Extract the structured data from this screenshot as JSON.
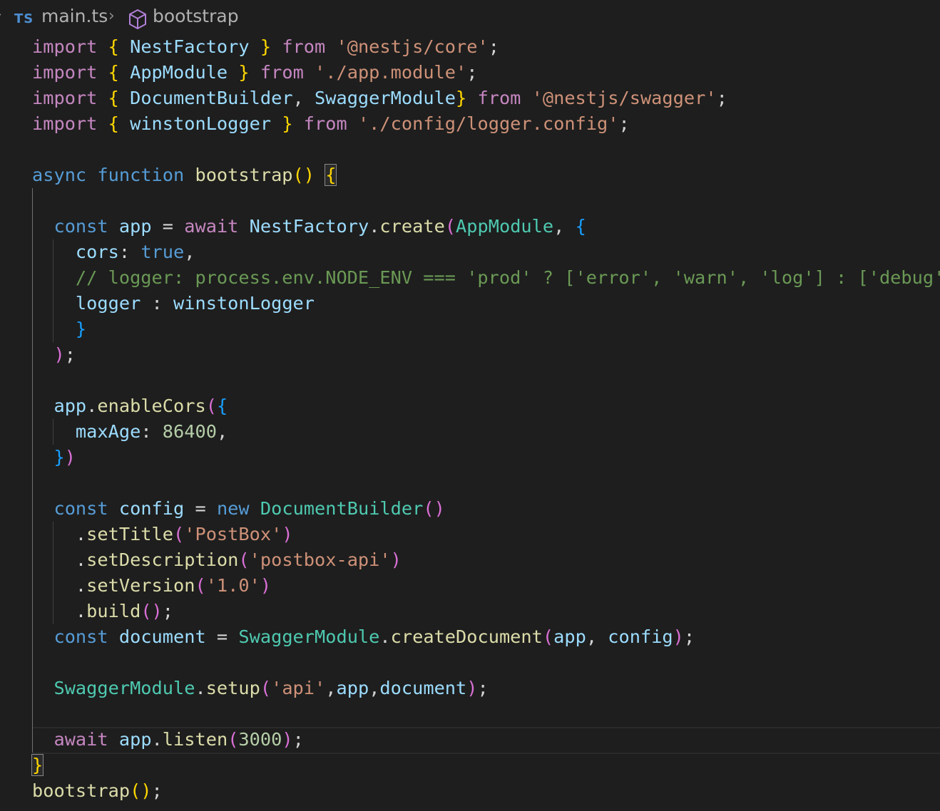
{
  "breadcrumb": {
    "chevron": "›",
    "file_icon": "TS",
    "file": "main.ts",
    "separator": "›",
    "symbol_icon": "cube-symbol-icon",
    "symbol": "bootstrap"
  },
  "lines": [
    [
      [
        "kw",
        "import"
      ],
      [
        "op",
        " "
      ],
      [
        "b1",
        "{"
      ],
      [
        "op",
        " "
      ],
      [
        "var",
        "NestFactory"
      ],
      [
        "op",
        " "
      ],
      [
        "b1",
        "}"
      ],
      [
        "op",
        " "
      ],
      [
        "kw",
        "from"
      ],
      [
        "op",
        " "
      ],
      [
        "str",
        "'@nestjs/core'"
      ],
      [
        "op",
        ";"
      ]
    ],
    [
      [
        "kw",
        "import"
      ],
      [
        "op",
        " "
      ],
      [
        "b1",
        "{"
      ],
      [
        "op",
        " "
      ],
      [
        "var",
        "AppModule"
      ],
      [
        "op",
        " "
      ],
      [
        "b1",
        "}"
      ],
      [
        "op",
        " "
      ],
      [
        "kw",
        "from"
      ],
      [
        "op",
        " "
      ],
      [
        "str",
        "'./app.module'"
      ],
      [
        "op",
        ";"
      ]
    ],
    [
      [
        "kw",
        "import"
      ],
      [
        "op",
        " "
      ],
      [
        "b1",
        "{"
      ],
      [
        "op",
        " "
      ],
      [
        "var",
        "DocumentBuilder"
      ],
      [
        "op",
        ", "
      ],
      [
        "var",
        "SwaggerModule"
      ],
      [
        "b1",
        "}"
      ],
      [
        "op",
        " "
      ],
      [
        "kw",
        "from"
      ],
      [
        "op",
        " "
      ],
      [
        "str",
        "'@nestjs/swagger'"
      ],
      [
        "op",
        ";"
      ]
    ],
    [
      [
        "kw",
        "import"
      ],
      [
        "op",
        " "
      ],
      [
        "b1",
        "{"
      ],
      [
        "op",
        " "
      ],
      [
        "var",
        "winstonLogger"
      ],
      [
        "op",
        " "
      ],
      [
        "b1",
        "}"
      ],
      [
        "op",
        " "
      ],
      [
        "kw",
        "from"
      ],
      [
        "op",
        " "
      ],
      [
        "str",
        "'./config/logger.config'"
      ],
      [
        "op",
        ";"
      ]
    ],
    [],
    [
      [
        "st",
        "async"
      ],
      [
        "op",
        " "
      ],
      [
        "st",
        "function"
      ],
      [
        "op",
        " "
      ],
      [
        "fn",
        "bootstrap"
      ],
      [
        "b1",
        "()"
      ],
      [
        "op",
        " "
      ],
      [
        "b1 match",
        "{"
      ]
    ],
    [],
    [
      [
        "op",
        "  "
      ],
      [
        "st",
        "const"
      ],
      [
        "op",
        " "
      ],
      [
        "var",
        "app"
      ],
      [
        "op",
        " = "
      ],
      [
        "kw",
        "await"
      ],
      [
        "op",
        " "
      ],
      [
        "var",
        "NestFactory"
      ],
      [
        "op",
        "."
      ],
      [
        "fn",
        "create"
      ],
      [
        "b2",
        "("
      ],
      [
        "cls",
        "AppModule"
      ],
      [
        "op",
        ", "
      ],
      [
        "b3",
        "{"
      ]
    ],
    [
      [
        "op",
        "    "
      ],
      [
        "var",
        "cors"
      ],
      [
        "op",
        ": "
      ],
      [
        "st",
        "true"
      ],
      [
        "op",
        ","
      ]
    ],
    [
      [
        "op",
        "    "
      ],
      [
        "cm",
        "// logger: process.env.NODE_ENV === 'prod' ? ['error', 'warn', 'log'] : ['debug'],"
      ]
    ],
    [
      [
        "op",
        "    "
      ],
      [
        "var",
        "logger"
      ],
      [
        "op",
        " : "
      ],
      [
        "var",
        "winstonLogger"
      ]
    ],
    [
      [
        "op",
        "    "
      ],
      [
        "b3",
        "}"
      ]
    ],
    [
      [
        "op",
        "  "
      ],
      [
        "b2",
        ")"
      ],
      [
        "op",
        ";"
      ]
    ],
    [],
    [
      [
        "op",
        "  "
      ],
      [
        "var",
        "app"
      ],
      [
        "op",
        "."
      ],
      [
        "fn",
        "enableCors"
      ],
      [
        "b2",
        "("
      ],
      [
        "b3",
        "{"
      ]
    ],
    [
      [
        "op",
        "    "
      ],
      [
        "var",
        "maxAge"
      ],
      [
        "op",
        ": "
      ],
      [
        "num",
        "86400"
      ],
      [
        "op",
        ","
      ]
    ],
    [
      [
        "op",
        "  "
      ],
      [
        "b3",
        "}"
      ],
      [
        "b2",
        ")"
      ]
    ],
    [],
    [
      [
        "op",
        "  "
      ],
      [
        "st",
        "const"
      ],
      [
        "op",
        " "
      ],
      [
        "var",
        "config"
      ],
      [
        "op",
        " = "
      ],
      [
        "st",
        "new"
      ],
      [
        "op",
        " "
      ],
      [
        "cls",
        "DocumentBuilder"
      ],
      [
        "b2",
        "()"
      ]
    ],
    [
      [
        "op",
        "    ."
      ],
      [
        "fn",
        "setTitle"
      ],
      [
        "b2",
        "("
      ],
      [
        "str",
        "'PostBox'"
      ],
      [
        "b2",
        ")"
      ]
    ],
    [
      [
        "op",
        "    ."
      ],
      [
        "fn",
        "setDescription"
      ],
      [
        "b2",
        "("
      ],
      [
        "str",
        "'postbox-api'"
      ],
      [
        "b2",
        ")"
      ]
    ],
    [
      [
        "op",
        "    ."
      ],
      [
        "fn",
        "setVersion"
      ],
      [
        "b2",
        "("
      ],
      [
        "str",
        "'1.0'"
      ],
      [
        "b2",
        ")"
      ]
    ],
    [
      [
        "op",
        "    ."
      ],
      [
        "fn",
        "build"
      ],
      [
        "b2",
        "()"
      ],
      [
        "op",
        ";"
      ]
    ],
    [
      [
        "op",
        "  "
      ],
      [
        "st",
        "const"
      ],
      [
        "op",
        " "
      ],
      [
        "var",
        "document"
      ],
      [
        "op",
        " = "
      ],
      [
        "cls",
        "SwaggerModule"
      ],
      [
        "op",
        "."
      ],
      [
        "fn",
        "createDocument"
      ],
      [
        "b2",
        "("
      ],
      [
        "var",
        "app"
      ],
      [
        "op",
        ", "
      ],
      [
        "var",
        "config"
      ],
      [
        "b2",
        ")"
      ],
      [
        "op",
        ";"
      ]
    ],
    [],
    [
      [
        "op",
        "  "
      ],
      [
        "cls",
        "SwaggerModule"
      ],
      [
        "op",
        "."
      ],
      [
        "fn",
        "setup"
      ],
      [
        "b2",
        "("
      ],
      [
        "str",
        "'api'"
      ],
      [
        "op",
        ","
      ],
      [
        "var",
        "app"
      ],
      [
        "op",
        ","
      ],
      [
        "var",
        "document"
      ],
      [
        "b2",
        ")"
      ],
      [
        "op",
        ";"
      ]
    ],
    [],
    [
      [
        "op",
        "  "
      ],
      [
        "kw",
        "await"
      ],
      [
        "op",
        " "
      ],
      [
        "var",
        "app"
      ],
      [
        "op",
        "."
      ],
      [
        "fn",
        "listen"
      ],
      [
        "b2",
        "("
      ],
      [
        "num",
        "3000"
      ],
      [
        "b2",
        ")"
      ],
      [
        "op",
        ";"
      ]
    ],
    [
      [
        "b1 match",
        "}"
      ]
    ],
    [
      [
        "fn",
        "bootstrap"
      ],
      [
        "b1",
        "()"
      ],
      [
        "op",
        ";"
      ]
    ]
  ]
}
